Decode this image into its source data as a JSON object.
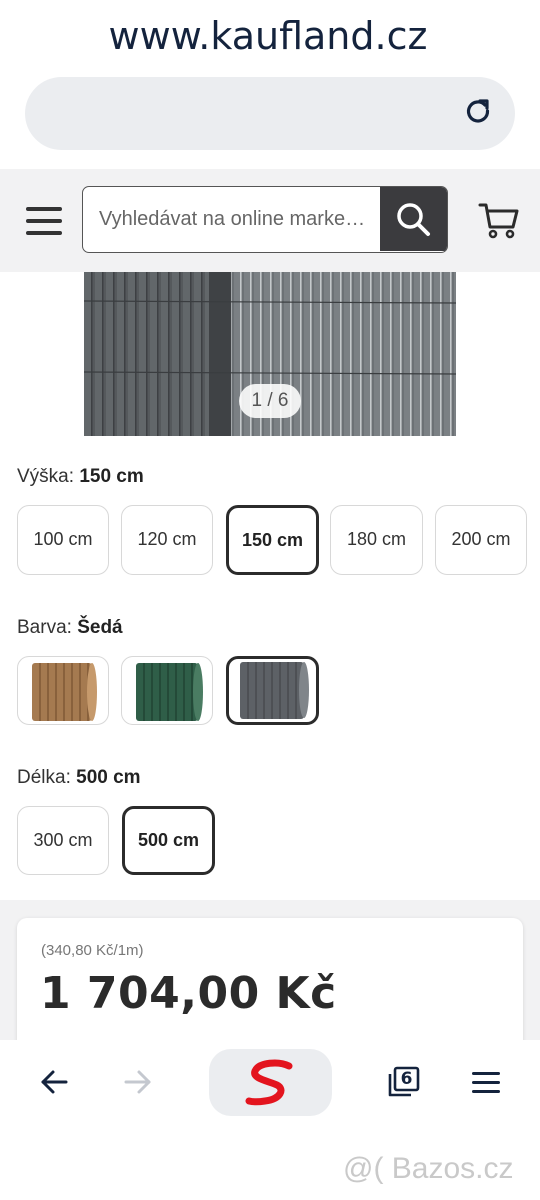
{
  "browser": {
    "url": "www.kaufland.cz"
  },
  "header": {
    "search_placeholder": "Vyhledávat na online marke…"
  },
  "gallery": {
    "counter": "1 / 6"
  },
  "options": {
    "height": {
      "label": "Výška:",
      "selected": "150 cm",
      "choices": [
        "100 cm",
        "120 cm",
        "150 cm",
        "180 cm",
        "200 cm"
      ]
    },
    "color": {
      "label": "Barva:",
      "selected": "Šedá",
      "swatches": [
        {
          "name": "brown",
          "color": "#a57a50"
        },
        {
          "name": "green",
          "color": "#2f5e48"
        },
        {
          "name": "grey",
          "color": "#5d6166"
        }
      ]
    },
    "length": {
      "label": "Délka:",
      "selected": "500 cm",
      "choices": [
        "300 cm",
        "500 cm"
      ]
    }
  },
  "price": {
    "unit": "(340,80 Kč/1m)",
    "total": "1 704,00 Kč"
  },
  "bottom_nav": {
    "tabs_count": "6"
  },
  "watermark": "@( Bazos.cz",
  "colors": {
    "accent_red": "#e3141e",
    "dark": "#2b2b2b"
  }
}
